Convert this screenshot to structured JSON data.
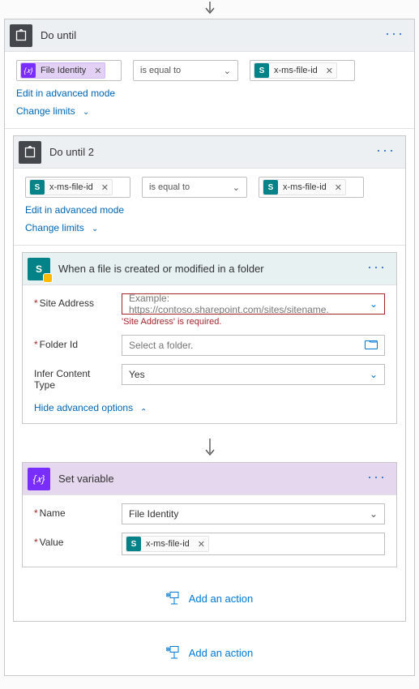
{
  "outer": {
    "title": "Do until",
    "condition": {
      "left_token": {
        "type": "var",
        "label": "File Identity"
      },
      "operator": "is equal to",
      "right_token": {
        "type": "sp",
        "label": "x-ms-file-id"
      }
    },
    "links": {
      "advanced_mode": "Edit in advanced mode",
      "change_limits": "Change limits"
    }
  },
  "inner": {
    "title": "Do until 2",
    "condition": {
      "left_token": {
        "type": "sp",
        "label": "x-ms-file-id"
      },
      "operator": "is equal to",
      "right_token": {
        "type": "sp",
        "label": "x-ms-file-id"
      }
    },
    "links": {
      "advanced_mode": "Edit in advanced mode",
      "change_limits": "Change limits"
    }
  },
  "sp_action": {
    "title": "When a file is created or modified in a folder",
    "fields": {
      "site_address": {
        "label": "Site Address",
        "placeholder": "Example: https://contoso.sharepoint.com/sites/sitename.",
        "error": "'Site Address' is required."
      },
      "folder_id": {
        "label": "Folder Id",
        "placeholder": "Select a folder."
      },
      "infer_content_type": {
        "label": "Infer Content Type",
        "value": "Yes"
      }
    },
    "hide_advanced": "Hide advanced options"
  },
  "set_var": {
    "title": "Set variable",
    "name": {
      "label": "Name",
      "value": "File Identity"
    },
    "value": {
      "label": "Value",
      "token": {
        "type": "sp",
        "label": "x-ms-file-id"
      }
    }
  },
  "shared": {
    "add_action": "Add an action"
  }
}
